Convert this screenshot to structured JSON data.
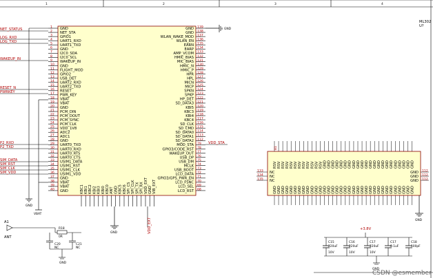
{
  "sheet": {
    "column_numbers": [
      "1",
      "2",
      "3",
      "4"
    ],
    "gnd": "GND",
    "vbat": "VBAT",
    "vdd_ext": "VDD_EXT",
    "ant": "ANT",
    "v3v8": "+3.8V"
  },
  "module": {
    "ref": "U?",
    "part": "ML302",
    "left_pins": [
      {
        "num": "1",
        "name": "GND"
      },
      {
        "num": "2",
        "name": "NET_STA"
      },
      {
        "num": "3",
        "name": "GPIO1"
      },
      {
        "num": "4",
        "name": "UART1_RXD"
      },
      {
        "num": "5",
        "name": "UART1_TXD"
      },
      {
        "num": "6",
        "name": "GND"
      },
      {
        "num": "7",
        "name": "I2C0_SDA"
      },
      {
        "num": "8",
        "name": "I2C0_SCL"
      },
      {
        "num": "9",
        "name": "WAKEUP_IN"
      },
      {
        "num": "10",
        "name": "GND"
      },
      {
        "num": "11",
        "name": "FLIGHT_MOD"
      },
      {
        "num": "12",
        "name": "GPIO2"
      },
      {
        "num": "13",
        "name": "USB_DET"
      },
      {
        "num": "14",
        "name": "UART2_RXD"
      },
      {
        "num": "15",
        "name": "UART2_TXD"
      },
      {
        "num": "16",
        "name": "RESET"
      },
      {
        "num": "17",
        "name": "PWR_KEY"
      },
      {
        "num": "18",
        "name": "VBAT"
      },
      {
        "num": "19",
        "name": "VBAT"
      },
      {
        "num": "20",
        "name": "GND"
      },
      {
        "num": "21",
        "name": "PCM_DIN"
      },
      {
        "num": "22",
        "name": "PCM_DOUT"
      },
      {
        "num": "23",
        "name": "PCM_SYNC"
      },
      {
        "num": "24",
        "name": "PCM_CLK"
      },
      {
        "num": "25",
        "name": "VDD_1V8"
      },
      {
        "num": "26",
        "name": "ADC2"
      },
      {
        "num": "27",
        "name": "ADC1"
      },
      {
        "num": "28",
        "name": "GND"
      },
      {
        "num": "29",
        "name": "UART0_TXD"
      },
      {
        "num": "30",
        "name": "UART0_RXD"
      },
      {
        "num": "31",
        "name": "UART0_RTS"
      },
      {
        "num": "32",
        "name": "UART0_CTS"
      },
      {
        "num": "33",
        "name": "USIM1_DATA"
      },
      {
        "num": "34",
        "name": "USIM1_RST"
      },
      {
        "num": "35",
        "name": "USIM1_CLK"
      },
      {
        "num": "36",
        "name": "USIM1_VDD"
      },
      {
        "num": "37",
        "name": "GND"
      },
      {
        "num": "38",
        "name": "VBAT"
      },
      {
        "num": "39",
        "name": "VBAT"
      },
      {
        "num": "40",
        "name": "GND"
      }
    ],
    "right_pins": [
      {
        "num": "139",
        "name": "GND"
      },
      {
        "num": "138",
        "name": "GND"
      },
      {
        "num": "137",
        "name": "WLAN_WAKE_MOD"
      },
      {
        "num": "136",
        "name": "WLAN_EN"
      },
      {
        "num": "135",
        "name": "EARN"
      },
      {
        "num": "134",
        "name": "EARP"
      },
      {
        "num": "133",
        "name": "AMP_VCOM"
      },
      {
        "num": "132",
        "name": "HMIC_BIAS"
      },
      {
        "num": "131",
        "name": "MIC_BIAS"
      },
      {
        "num": "130",
        "name": "HMIC_N"
      },
      {
        "num": "129",
        "name": "HMIC_P"
      },
      {
        "num": "128",
        "name": "HPR"
      },
      {
        "num": "127",
        "name": "HPL"
      },
      {
        "num": "126",
        "name": "MICN"
      },
      {
        "num": "125",
        "name": "MICP"
      },
      {
        "num": "124",
        "name": "SPKN"
      },
      {
        "num": "123",
        "name": "SPKP"
      },
      {
        "num": "122",
        "name": "HP_DET"
      },
      {
        "num": "121",
        "name": "SD_DATA3"
      },
      {
        "num": "120",
        "name": "KBI5"
      },
      {
        "num": "119",
        "name": "KBC3"
      },
      {
        "num": "118",
        "name": "KBI4"
      },
      {
        "num": "117",
        "name": "KBC4"
      },
      {
        "num": "116",
        "name": "SD_CLK"
      },
      {
        "num": "115",
        "name": "SD_CMD"
      },
      {
        "num": "114",
        "name": "SD_DATA0"
      },
      {
        "num": "113",
        "name": "SD_DATA1"
      },
      {
        "num": "112",
        "name": "SD_DATA2"
      },
      {
        "num": "79",
        "name": "MOD_STA"
      },
      {
        "num": "78",
        "name": "GPIO3/CODE_RST"
      },
      {
        "num": "77",
        "name": "WAKEUP_OUT"
      },
      {
        "num": "76",
        "name": "USB_DP"
      },
      {
        "num": "75",
        "name": "USB_DM"
      },
      {
        "num": "74",
        "name": "MCLK"
      },
      {
        "num": "73",
        "name": "USB_BOOT"
      },
      {
        "num": "72",
        "name": "LCD_DATA"
      },
      {
        "num": "71",
        "name": "GPIO3/GPS_PWR_EN"
      },
      {
        "num": "70",
        "name": "LCD_FSNC"
      },
      {
        "num": "69",
        "name": "LCD_SEL"
      },
      {
        "num": "68",
        "name": "LCD_RST"
      }
    ],
    "bottom_pins": [
      "KBC1",
      "KBI1",
      "KBC2",
      "KBI2",
      "KBI3",
      "KBI0",
      "KBC0",
      "ANT",
      "GND",
      "KBC5",
      "KBC6",
      "SPI_CS",
      "SPI_CLK",
      "SPI_TX",
      "SPI_RX",
      "VDD_EXT",
      "GND",
      "VIB_EXT"
    ]
  },
  "net_labels": [
    {
      "text": "NET_STATUS"
    },
    {
      "text": "LOG_RXD"
    },
    {
      "text": "LOG_TXD"
    },
    {
      "text": "WAKEUP_IN"
    },
    {
      "text": "RESET_N"
    },
    {
      "text": "PWRKEY"
    },
    {
      "text": "P2_RXD"
    },
    {
      "text": "P2_TXD"
    },
    {
      "text": "SIM_DATA"
    },
    {
      "text": "SIM_RST"
    },
    {
      "text": "SIM_CLK"
    },
    {
      "text": "SIM_VDD"
    }
  ],
  "vdd_sta_label": "VDD_STA",
  "grid": {
    "top_nums": [
      "81",
      "..."
    ],
    "col_labels": [
      "RSV",
      "RSV",
      "RSV",
      "RSV",
      "RSV",
      "RSV",
      "RSV",
      "RSV",
      "RSV",
      "RSV",
      "RSV",
      "RSV",
      "GND",
      "GND",
      "GND",
      "GND",
      "GND",
      "GND",
      "GND",
      "GND",
      "GND",
      "GND",
      "GND",
      "GND",
      "GND",
      "GND",
      "GND",
      "GND",
      "GND",
      "GND",
      "GND",
      "GND",
      "GND",
      "GND"
    ],
    "left_side": [
      {
        "num": "133",
        "name": "NC"
      },
      {
        "num": "134",
        "name": "NC"
      },
      {
        "num": "135",
        "name": "NC"
      }
    ],
    "right_side": [
      {
        "num": "112",
        "name": "GND"
      },
      {
        "num": "112",
        "name": "GND"
      },
      {
        "num": "112",
        "name": "GND"
      }
    ]
  },
  "antenna": {
    "ref": "A1",
    "r": "R18",
    "r_val": "0R",
    "c1": "C20",
    "c1_val": "NC",
    "c2": "C21",
    "c2_val": "NC"
  },
  "caps": [
    {
      "ref": "C15",
      "val": "220uF",
      "v": "10V"
    },
    {
      "ref": "C16",
      "val": "220uF",
      "v": "10V"
    },
    {
      "ref": "C17",
      "val": "220uF",
      "v": "10V"
    },
    {
      "ref": "C17",
      "val": "0.1uF",
      "v": ""
    },
    {
      "ref": "C18",
      "val": "100pF",
      "v": ""
    }
  ],
  "watermark": "CSDN @esmember"
}
